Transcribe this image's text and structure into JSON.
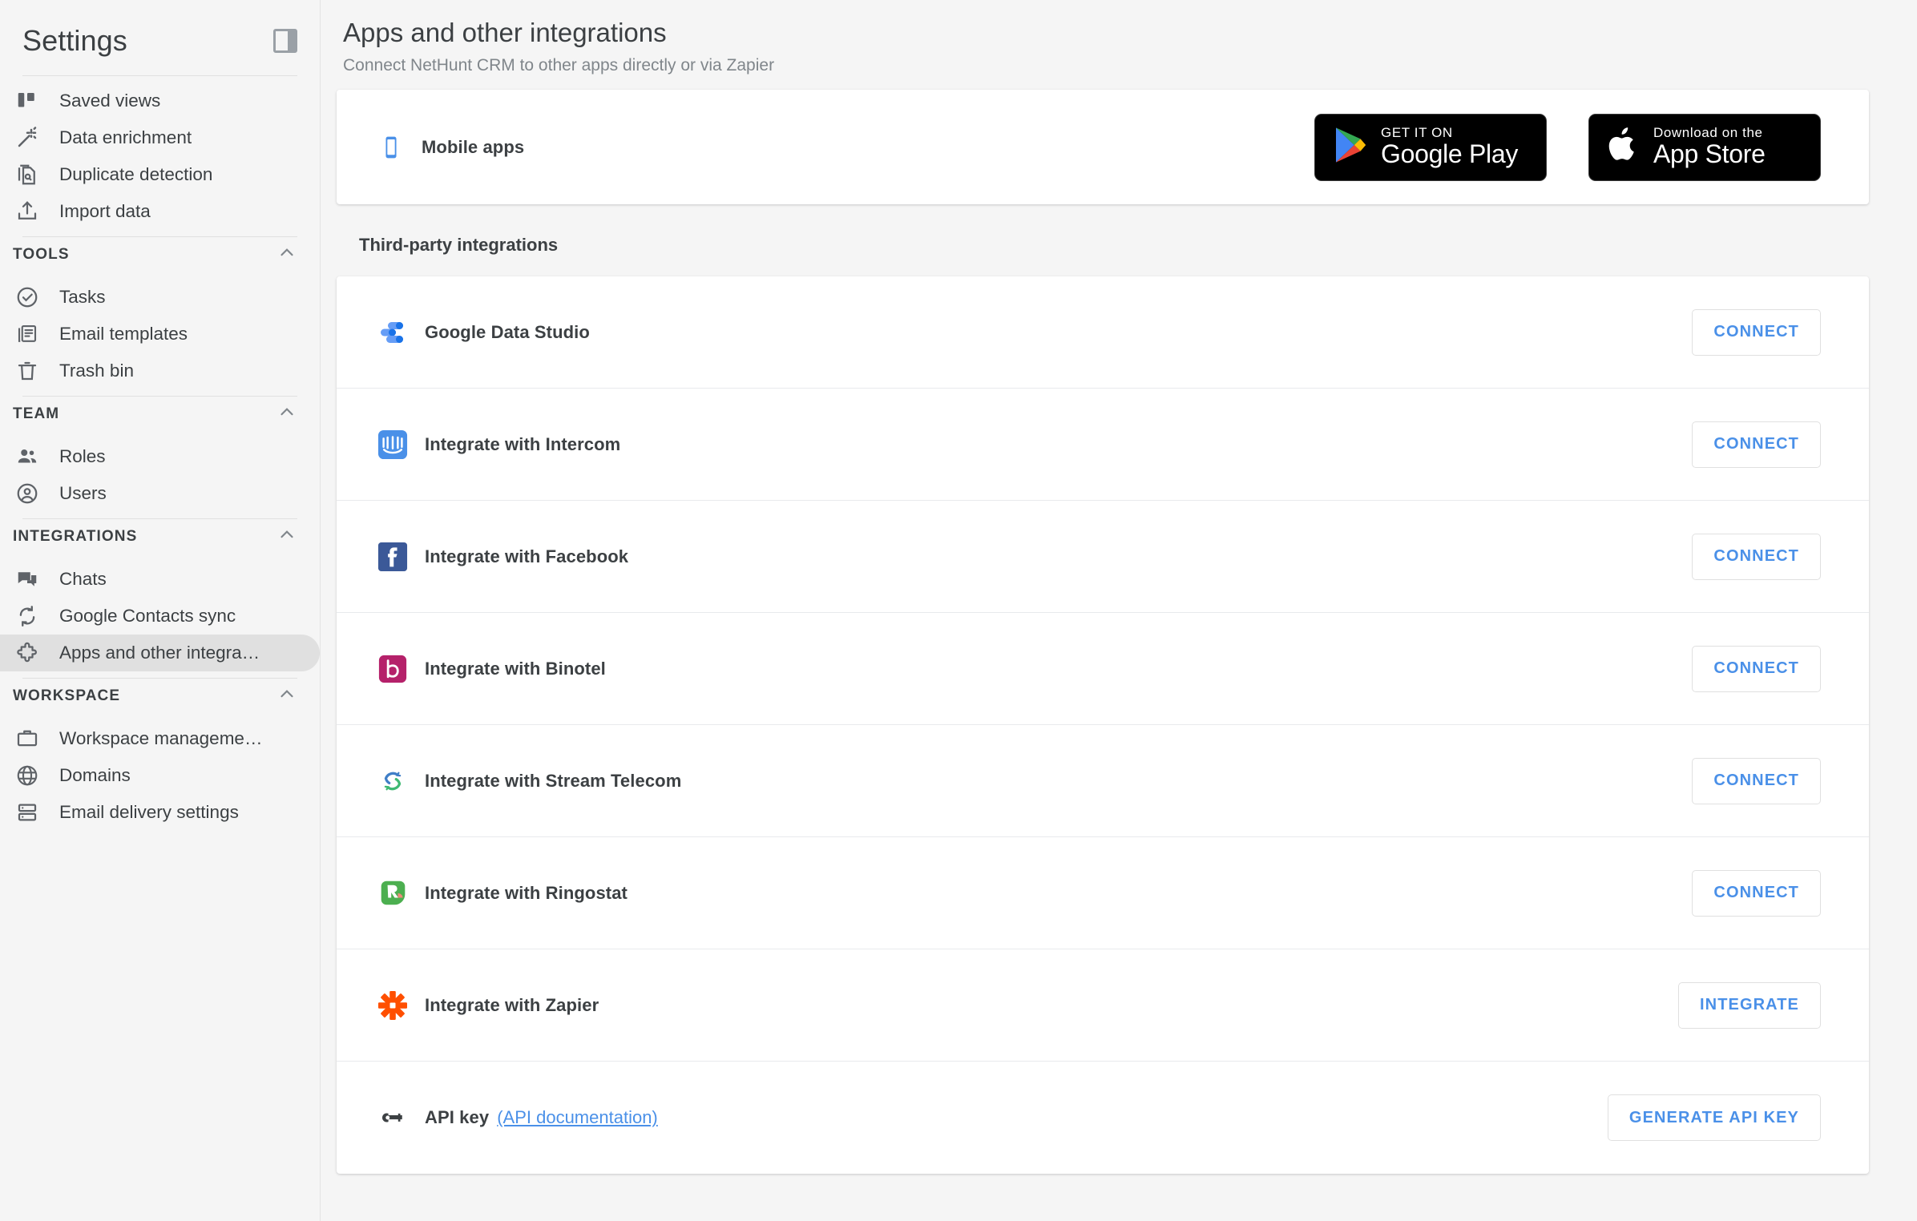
{
  "sidebar": {
    "title": "Settings",
    "panel_toggle_icon": "panel-collapse-icon",
    "top_items": [
      {
        "label": "Saved views",
        "icon": "saved-views-icon"
      },
      {
        "label": "Data enrichment",
        "icon": "magic-wand-icon"
      },
      {
        "label": "Duplicate detection",
        "icon": "duplicate-document-icon"
      },
      {
        "label": "Import data",
        "icon": "upload-icon"
      }
    ],
    "groups": [
      {
        "title": "TOOLS",
        "collapse_icon": "chevron-up-icon",
        "items": [
          {
            "label": "Tasks",
            "icon": "check-circle-icon"
          },
          {
            "label": "Email templates",
            "icon": "email-template-icon"
          },
          {
            "label": "Trash bin",
            "icon": "trash-icon"
          }
        ]
      },
      {
        "title": "TEAM",
        "collapse_icon": "chevron-up-icon",
        "items": [
          {
            "label": "Roles",
            "icon": "people-icon"
          },
          {
            "label": "Users",
            "icon": "account-circle-icon"
          }
        ]
      },
      {
        "title": "INTEGRATIONS",
        "collapse_icon": "chevron-up-icon",
        "items": [
          {
            "label": "Chats",
            "icon": "chat-bubbles-icon"
          },
          {
            "label": "Google Contacts sync",
            "icon": "sync-icon"
          },
          {
            "label": "Apps and other integra…",
            "icon": "puzzle-piece-icon",
            "active": true
          }
        ]
      },
      {
        "title": "WORKSPACE",
        "collapse_icon": "chevron-up-icon",
        "items": [
          {
            "label": "Workspace manageme…",
            "icon": "briefcase-icon"
          },
          {
            "label": "Domains",
            "icon": "globe-icon"
          },
          {
            "label": "Email delivery settings",
            "icon": "server-icon"
          }
        ]
      }
    ]
  },
  "header": {
    "title": "Apps and other integrations",
    "subtitle": "Connect NetHunt CRM to other apps directly or via Zapier"
  },
  "mobile_apps": {
    "title": "Mobile apps",
    "icon": "smartphone-icon",
    "google_play": {
      "icon": "google-play-icon",
      "small_text": "GET IT ON",
      "big_text": "Google Play"
    },
    "app_store": {
      "icon": "apple-icon",
      "small_text": "Download on the",
      "big_text": "App Store"
    }
  },
  "third_party": {
    "section_label": "Third-party integrations",
    "rows": [
      {
        "name": "Google Data Studio",
        "icon": "google-data-studio-icon",
        "button": "CONNECT"
      },
      {
        "name": "Integrate with Intercom",
        "icon": "intercom-icon",
        "button": "CONNECT"
      },
      {
        "name": "Integrate with Facebook",
        "icon": "facebook-icon",
        "button": "CONNECT"
      },
      {
        "name": "Integrate with Binotel",
        "icon": "binotel-icon",
        "button": "CONNECT"
      },
      {
        "name": "Integrate with Stream Telecom",
        "icon": "stream-telecom-icon",
        "button": "CONNECT"
      },
      {
        "name": "Integrate with Ringostat",
        "icon": "ringostat-icon",
        "button": "CONNECT"
      },
      {
        "name": "Integrate with Zapier",
        "icon": "zapier-icon",
        "button": "INTEGRATE"
      }
    ],
    "api_key": {
      "name": "API key",
      "icon": "key-icon",
      "doc_link": "(API documentation)",
      "button": "GENERATE API KEY"
    }
  },
  "colors": {
    "accent_blue": "#4a90e8",
    "sidebar_bg": "#f5f5f5",
    "active_item_bg": "#e0e0e0",
    "text_primary": "#3c4043",
    "text_secondary": "#80868b"
  }
}
